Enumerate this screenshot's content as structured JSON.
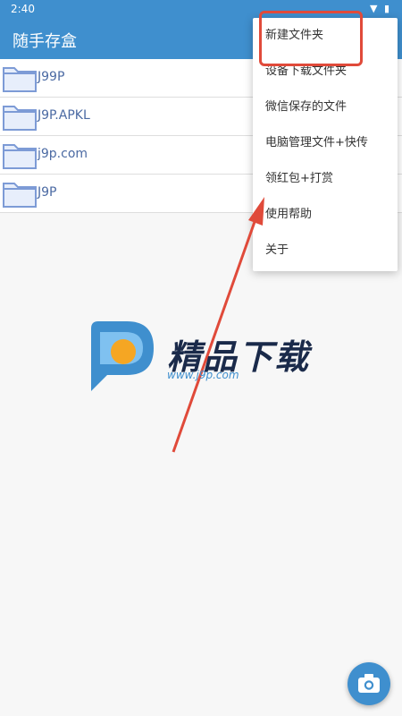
{
  "status": {
    "time": "2:40"
  },
  "appbar": {
    "title": "随手存盒"
  },
  "files": [
    {
      "name": "J99P"
    },
    {
      "name": "J9P.APKL"
    },
    {
      "name": "j9p.com"
    },
    {
      "name": "J9P"
    }
  ],
  "menu": {
    "items": [
      {
        "label": "新建文件夹"
      },
      {
        "label": "设备下载文件夹"
      },
      {
        "label": "微信保存的文件"
      },
      {
        "label": "电脑管理文件+快传"
      },
      {
        "label": "领红包+打赏"
      },
      {
        "label": "使用帮助"
      },
      {
        "label": "关于"
      }
    ]
  },
  "watermark": {
    "brand": "精品下载",
    "url": "www.j9p.com"
  },
  "colors": {
    "primary": "#3f8fce",
    "highlight": "#e04a3a",
    "logo_orange": "#f5a623"
  },
  "icons": [
    "wifi-icon",
    "battery-icon",
    "folder-icon",
    "camera-icon"
  ]
}
